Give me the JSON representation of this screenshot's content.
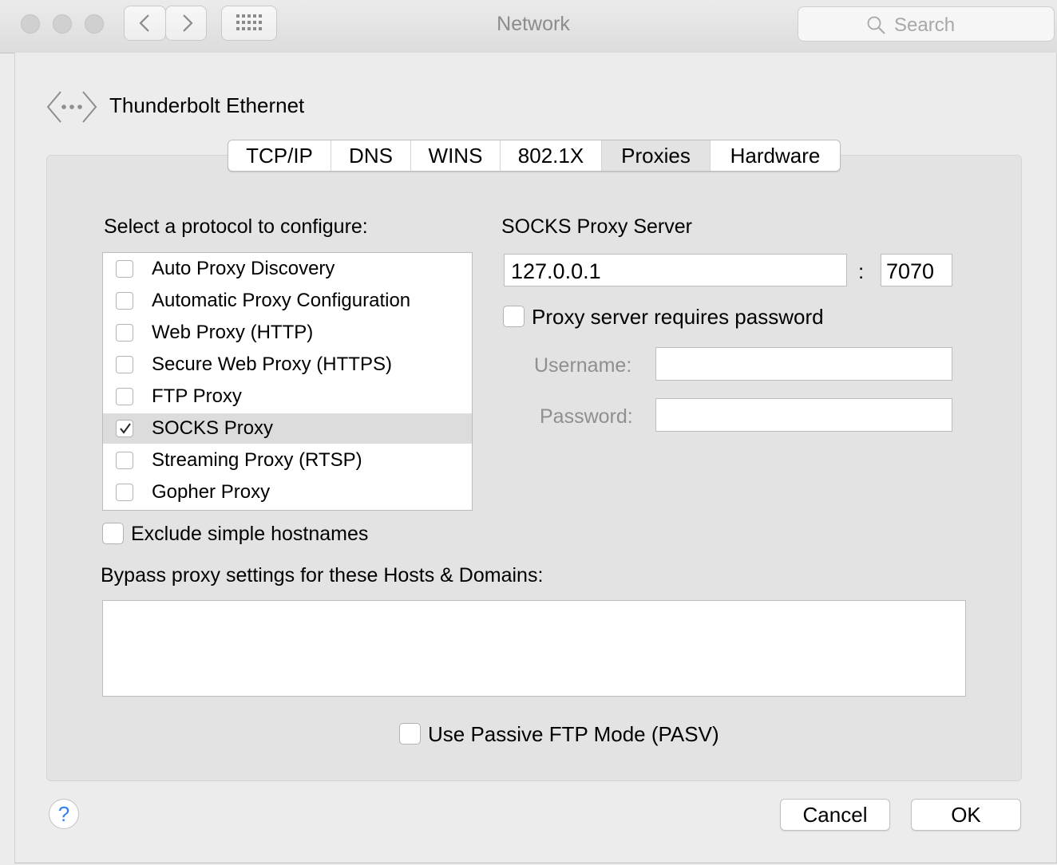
{
  "window": {
    "title": "Network"
  },
  "search": {
    "placeholder": "Search"
  },
  "interface": {
    "name": "Thunderbolt Ethernet"
  },
  "tabs": [
    {
      "label": "TCP/IP",
      "selected": false
    },
    {
      "label": "DNS",
      "selected": false
    },
    {
      "label": "WINS",
      "selected": false
    },
    {
      "label": "802.1X",
      "selected": false
    },
    {
      "label": "Proxies",
      "selected": true
    },
    {
      "label": "Hardware",
      "selected": false
    }
  ],
  "protocols": {
    "heading": "Select a protocol to configure:",
    "items": [
      {
        "label": "Auto Proxy Discovery",
        "checked": false
      },
      {
        "label": "Automatic Proxy Configuration",
        "checked": false
      },
      {
        "label": "Web Proxy (HTTP)",
        "checked": false
      },
      {
        "label": "Secure Web Proxy (HTTPS)",
        "checked": false
      },
      {
        "label": "FTP Proxy",
        "checked": false
      },
      {
        "label": "SOCKS Proxy",
        "checked": true
      },
      {
        "label": "Streaming Proxy (RTSP)",
        "checked": false
      },
      {
        "label": "Gopher Proxy",
        "checked": false
      }
    ]
  },
  "server": {
    "heading": "SOCKS Proxy Server",
    "host": "127.0.0.1",
    "separator": ":",
    "port": "7070",
    "requires_password_label": "Proxy server requires password",
    "requires_password": false,
    "username_label": "Username:",
    "username": "",
    "password_label": "Password:",
    "password": ""
  },
  "exclude_simple_hostnames": {
    "label": "Exclude simple hostnames",
    "checked": false
  },
  "bypass": {
    "label": "Bypass proxy settings for these Hosts & Domains:",
    "value": ""
  },
  "passive_ftp": {
    "label": "Use Passive FTP Mode (PASV)",
    "checked": false
  },
  "buttons": {
    "help": "?",
    "cancel": "Cancel",
    "ok": "OK"
  }
}
